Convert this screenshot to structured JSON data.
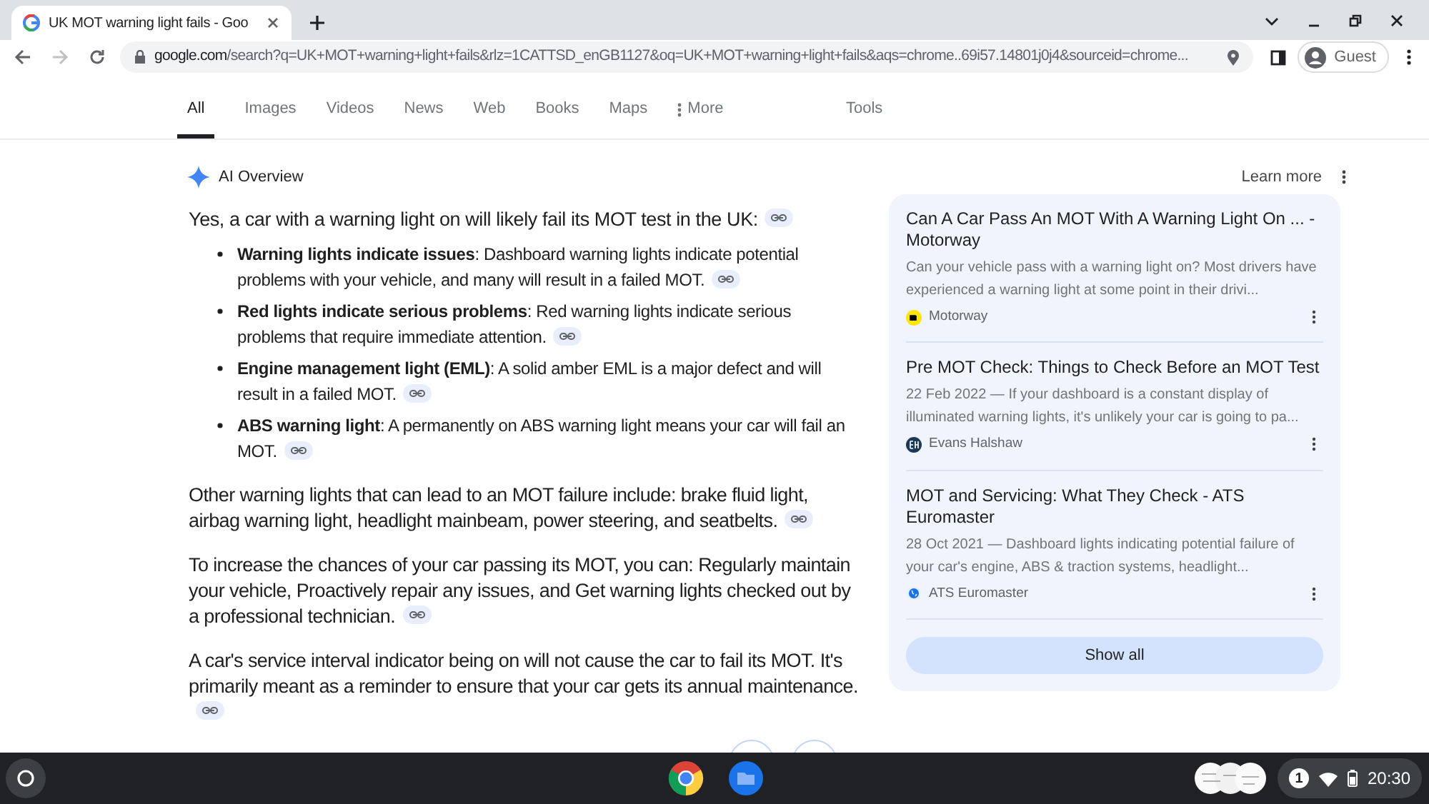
{
  "browser": {
    "tab_title": "UK MOT warning light fails - Goo",
    "url_host": "google.com",
    "url_rest": "/search?q=UK+MOT+warning+light+fails&rlz=1CATTSD_enGB1127&oq=UK+MOT+warning+light+fails&aqs=chrome..69i57.14801j0j4&sourceid=chrome...",
    "profile": "Guest"
  },
  "search_tabs": [
    {
      "label": "All",
      "selected": true
    },
    {
      "label": "Images",
      "selected": false
    },
    {
      "label": "Videos",
      "selected": false
    },
    {
      "label": "News",
      "selected": false
    },
    {
      "label": "Web",
      "selected": false
    },
    {
      "label": "Books",
      "selected": false
    },
    {
      "label": "Maps",
      "selected": false
    },
    {
      "label": "More",
      "selected": false
    }
  ],
  "tools": "Tools",
  "ai_overview": {
    "title": "AI Overview",
    "learn_more": "Learn more",
    "intro": "Yes, a car with a warning light on will likely fail its MOT test in the UK:",
    "bullets": [
      "**Warning lights indicate issues**: Dashboard warning lights indicate potential problems with your vehicle, and many will result in a failed MOT.",
      "**Red lights indicate serious problems**: Red warning lights indicate serious problems that require immediate attention.",
      "**Engine management light (EML)**: A solid amber EML is a major defect and will result in a failed MOT.",
      "**ABS warning light**: A permanently on ABS warning light means your car will fail an MOT."
    ],
    "paragraphs": [
      "Other warning lights that can lead to an MOT failure include: brake fluid light, airbag warning light, headlight mainbeam, power steering, and seatbelts.",
      "To increase the chances of your car passing its MOT, you can: Regularly maintain your vehicle, Proactively repair any issues, and Get warning lights checked out by a professional technician.",
      "A car's service interval indicator being on will not cause the car to fail its MOT. It's primarily meant as a reminder to ensure that your car gets its annual maintenance."
    ]
  },
  "sources": [
    {
      "title": "Can A Car Pass An MOT With A Warning Light On ... - Motorway",
      "snippet": "Can your vehicle pass with a warning light on? Most drivers have experienced a warning light at some point in their drivi...",
      "site": "Motorway",
      "kind": "badge"
    },
    {
      "title": "Pre MOT Check: Things to Check Before an MOT Test",
      "snippet": "22 Feb 2022 — If your dashboard is a constant display of illuminated warning lights, it's unlikely your car is going to pa...",
      "site": "Evans Halshaw",
      "kind": "monogram"
    },
    {
      "title": "MOT and Servicing: What They Check - ATS Euromaster",
      "snippet": "28 Oct 2021 — Dashboard lights indicating potential failure of your car's engine, ABS & traction systems, headlight...",
      "site": "ATS Euromaster",
      "kind": "globe"
    }
  ],
  "show_all": "Show all",
  "shelf": {
    "notifications": "1",
    "time": "20:30"
  }
}
